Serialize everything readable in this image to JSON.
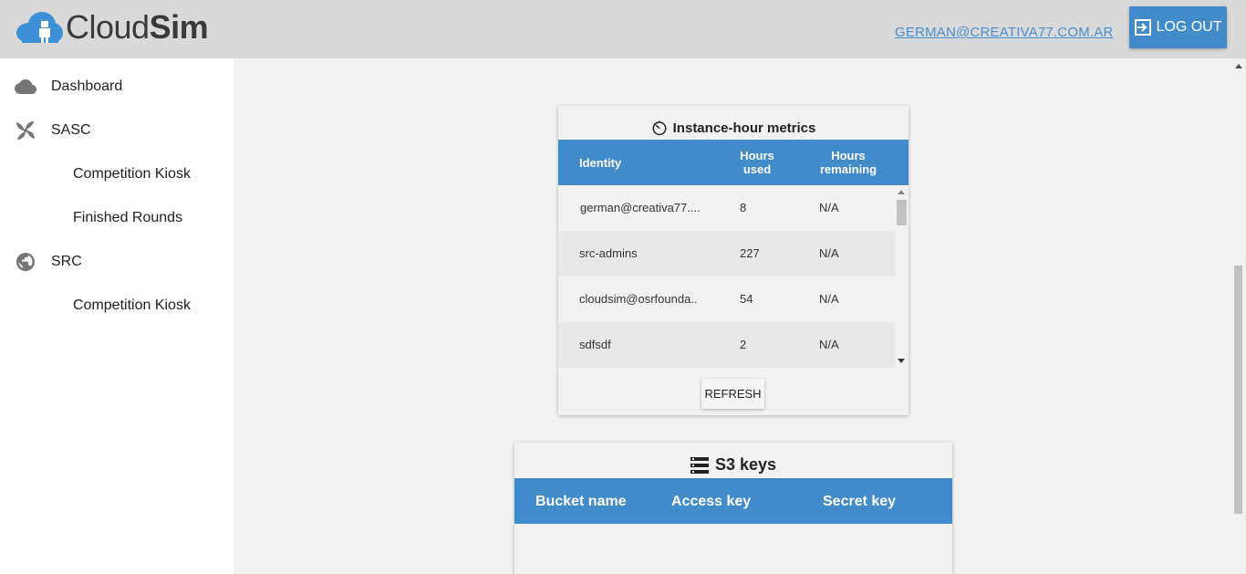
{
  "header": {
    "logo_light": "Cloud",
    "logo_bold": "Sim",
    "user_email": "GERMAN@CREATIVA77.COM.AR",
    "logout_label": "LOG OUT"
  },
  "sidebar": {
    "items": [
      {
        "label": "Dashboard",
        "icon": "cloud-icon"
      },
      {
        "label": "SASC",
        "icon": "pinwheel-icon"
      },
      {
        "label": "Competition Kiosk",
        "icon": ""
      },
      {
        "label": "Finished Rounds",
        "icon": ""
      },
      {
        "label": "SRC",
        "icon": "globe-icon"
      },
      {
        "label": "Competition Kiosk",
        "icon": ""
      }
    ]
  },
  "metrics": {
    "title": "Instance-hour metrics",
    "icon": "timer-icon",
    "columns": [
      "Identity",
      "Hours used",
      "Hours remaining"
    ],
    "rows": [
      {
        "identity": "german@creativa77....",
        "used": "8",
        "remaining": "N/A"
      },
      {
        "identity": "src-admins",
        "used": "227",
        "remaining": "N/A"
      },
      {
        "identity": "cloudsim@osrfounda..",
        "used": "54",
        "remaining": "N/A"
      },
      {
        "identity": "sdfsdf",
        "used": "2",
        "remaining": "N/A"
      }
    ],
    "refresh_label": "REFRESH"
  },
  "s3": {
    "title": "S3 keys",
    "icon": "storage-icon",
    "columns": [
      "Bucket name",
      "Access key",
      "Secret key"
    ]
  },
  "colors": {
    "accent": "#428bca",
    "header_bg": "#d9d9d9",
    "page_bg": "#f2f2f2"
  }
}
